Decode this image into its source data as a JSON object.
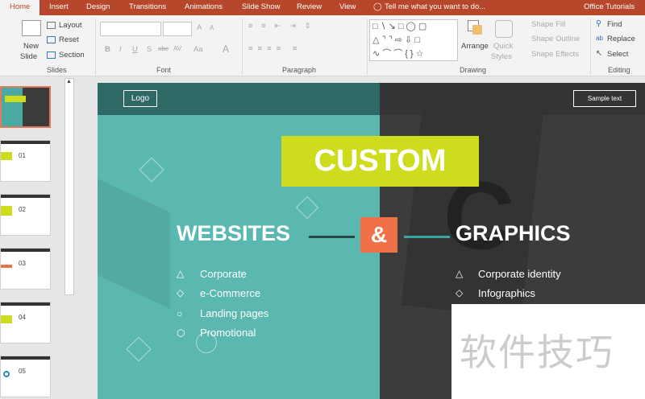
{
  "tabs": [
    "Home",
    "Insert",
    "Design",
    "Transitions",
    "Animations",
    "Slide Show",
    "Review",
    "View"
  ],
  "tell_me": "Tell me what you want to do...",
  "account": "Office Tutorials",
  "slides_group": {
    "new_slide": "New",
    "new_slide2": "Slide",
    "layout": "Layout",
    "reset": "Reset",
    "section": "Section",
    "label": "Slides"
  },
  "font_group": {
    "label": "Font",
    "bold": "B",
    "italic": "I",
    "underline": "U",
    "shadow": "S",
    "strike": "abc",
    "spacing": "AV",
    "case": "Aa",
    "color": "A",
    "grow": "A",
    "shrink": "A"
  },
  "paragraph_group": {
    "label": "Paragraph"
  },
  "drawing_group": {
    "label": "Drawing",
    "arrange": "Arrange",
    "quick": "Quick",
    "styles": "Styles",
    "fill": "Shape Fill",
    "outline": "Shape Outline",
    "effects": "Shape Effects"
  },
  "editing_group": {
    "label": "Editing",
    "find": "Find",
    "replace": "Replace",
    "select": "Select"
  },
  "thumbnails": [
    "01",
    "02",
    "03",
    "04",
    "05"
  ],
  "slide": {
    "logo": "Logo",
    "sample": "Sample text",
    "custom": "CUSTOM",
    "websites": "WEBSITES",
    "amp": "&",
    "graphics": "GRAPHICS",
    "left_items": [
      "Corporate",
      "e-Commerce",
      "Landing pages",
      "Promotional"
    ],
    "right_items": [
      "Corporate identity",
      "Infographics"
    ],
    "colors": {
      "teal": "#5bb8b0",
      "dark": "#3c3c3c",
      "lime": "#cddc1c",
      "orange": "#f07048"
    }
  },
  "watermark": "软件技巧"
}
